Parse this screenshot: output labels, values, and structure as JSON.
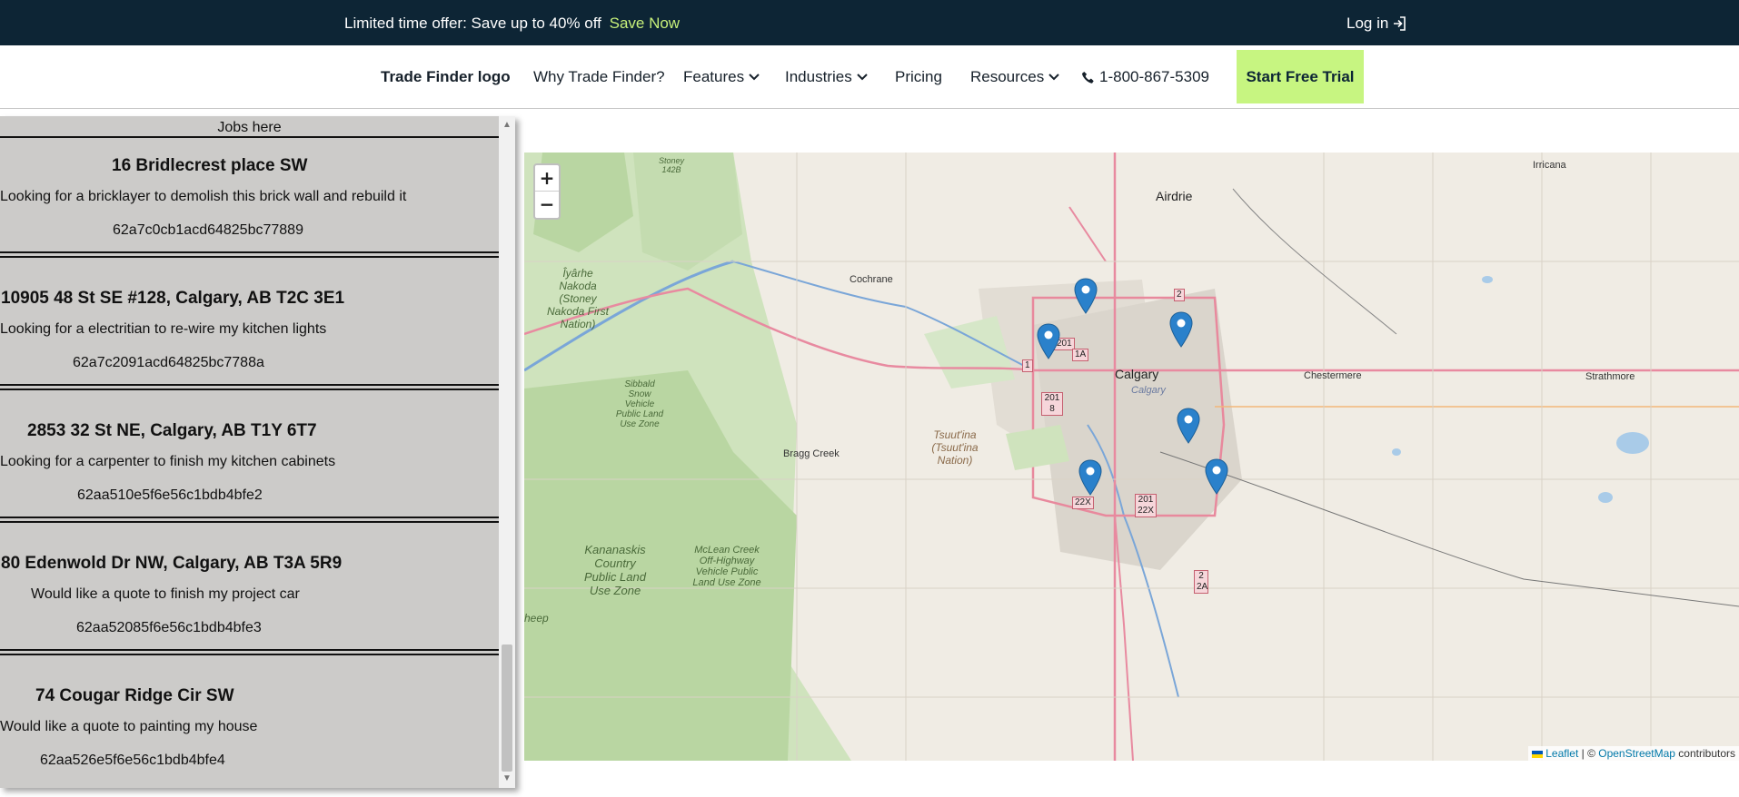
{
  "promo": {
    "offer_text": "Limited time offer: Save up to 40% off",
    "save_link": "Save Now",
    "login": "Log in"
  },
  "nav": {
    "logo": "Trade Finder logo",
    "why": "Why Trade Finder?",
    "features": "Features",
    "industries": "Industries",
    "pricing": "Pricing",
    "resources": "Resources",
    "phone": "1-800-867-5309",
    "trial": "Start Free Trial"
  },
  "jobs": {
    "heading": "Jobs here",
    "items": [
      {
        "address": "16 Bridlecrest place SW",
        "description": "Looking for a bricklayer to demolish this brick wall and rebuild it",
        "id": "62a7c0cb1acd64825bc77889"
      },
      {
        "address": "10905 48 St SE #128, Calgary, AB T2C 3E1",
        "description": "Looking for a electritian to re-wire my kitchen lights",
        "id": "62a7c2091acd64825bc7788a"
      },
      {
        "address": "2853 32 St NE, Calgary, AB T1Y 6T7",
        "description": "Looking for a carpenter to finish my kitchen cabinets",
        "id": "62aa510e5f6e56c1bdb4bfe2"
      },
      {
        "address": "80 Edenwold Dr NW, Calgary, AB T3A 5R9",
        "description": "Would like a quote to finish my project car",
        "id": "62aa52085f6e56c1bdb4bfe3"
      },
      {
        "address": "74 Cougar Ridge Cir SW",
        "description": "Would like a quote to painting my house",
        "id": "62aa526e5f6e56c1bdb4bfe4"
      }
    ]
  },
  "map": {
    "zoom_in": "+",
    "zoom_out": "−",
    "attribution": {
      "leaflet": "Leaflet",
      "sep": " | © ",
      "osm": "OpenStreetMap",
      "contributors": " contributors"
    },
    "labels": {
      "irricana": "Irricana",
      "airdrie": "Airdrie",
      "cochrane": "Cochrane",
      "calgary": "Calgary",
      "calgary_small": "Calgary",
      "chestermere": "Chestermere",
      "strathmore": "Strathmore",
      "bragg_creek": "Bragg Creek",
      "stoney_nakoda": "Îyârhe Nakoda (Stoney Nakoda First Nation)",
      "tsuut_ina": "Tsuut'ina (Tsuut'ina Nation)",
      "sibbald": "Sibbald Snow Vehicle Public Land Use Zone",
      "kananaskis": "Kananaskis Country Public Land Use Zone",
      "mclean": "McLean Creek Off-Highway Vehicle Public Land Use Zone",
      "stoney_1428": "Stoney 142B",
      "sheep": "heep"
    },
    "shields": {
      "s201a": "201",
      "s2": "2",
      "s1a": "1A",
      "s1": "1",
      "s2018": "201 8",
      "s22x": "22X",
      "s20122x": "201 22X",
      "s22a": "2 2A"
    }
  }
}
